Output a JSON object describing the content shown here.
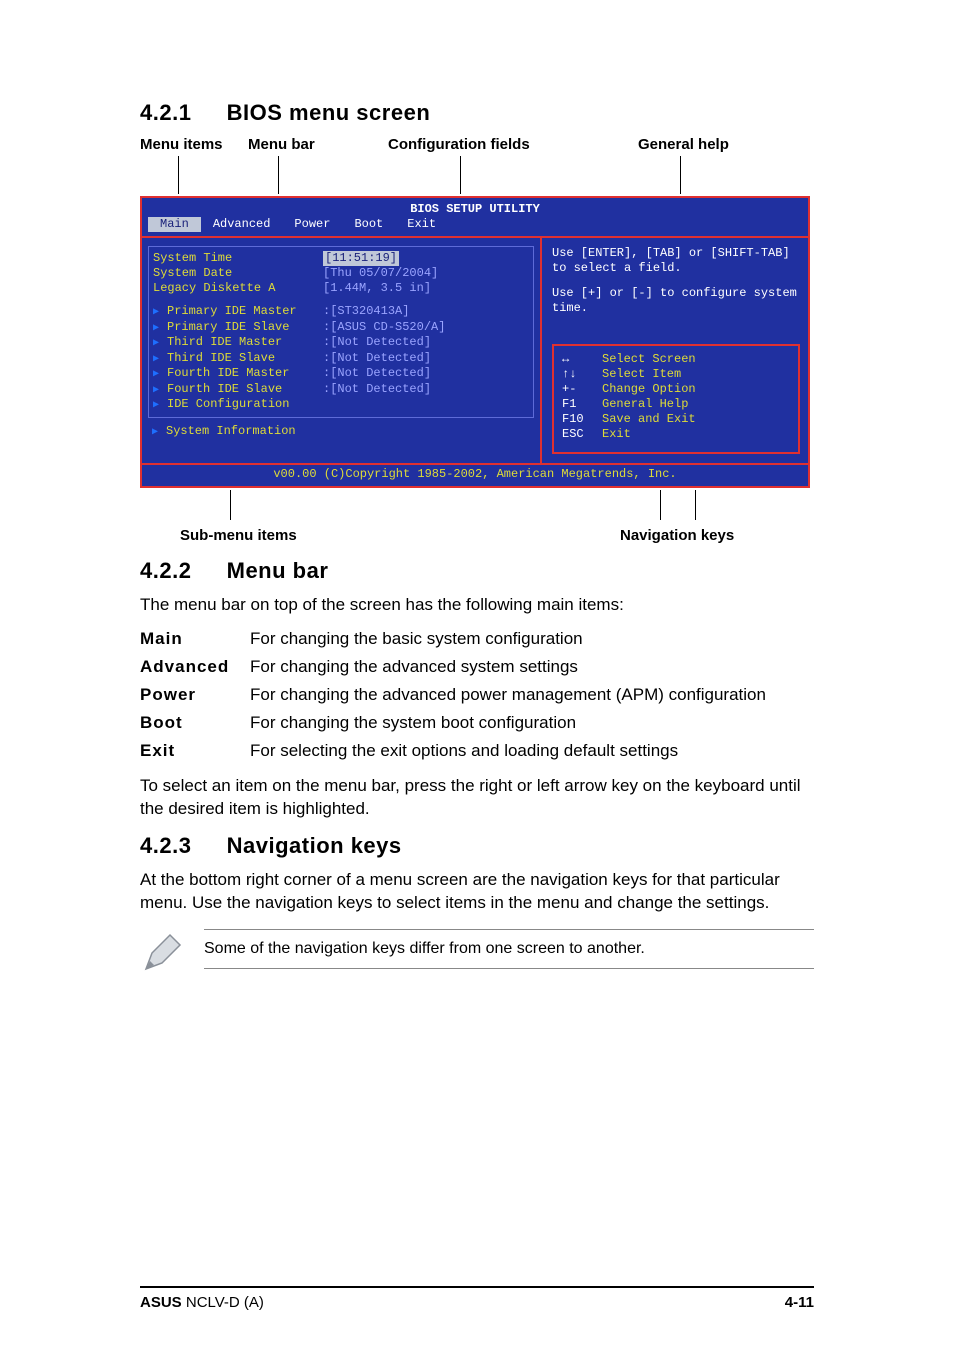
{
  "sections": {
    "s1": {
      "num": "4.2.1",
      "title": "BIOS menu screen"
    },
    "s2": {
      "num": "4.2.2",
      "title": "Menu bar"
    },
    "s3": {
      "num": "4.2.3",
      "title": "Navigation keys"
    }
  },
  "callouts": {
    "menu_items": "Menu items",
    "menu_bar": "Menu bar",
    "config_fields": "Configuration fields",
    "general_help": "General help",
    "submenu_items": "Sub-menu items",
    "nav_keys": "Navigation keys"
  },
  "bios": {
    "title": "BIOS SETUP UTILITY",
    "tabs": [
      "Main",
      "Advanced",
      "Power",
      "Boot",
      "Exit"
    ],
    "selected_tab": "Main",
    "top_rows": [
      {
        "label": "System Time",
        "value": "[11:51:19]",
        "sel": true
      },
      {
        "label": "System Date",
        "value": "[Thu 05/07/2004]"
      },
      {
        "label": "Legacy Diskette A",
        "value": "[1.44M, 3.5 in]"
      }
    ],
    "ide_rows": [
      {
        "label": "Primary IDE Master",
        "value": "[ST320413A]"
      },
      {
        "label": "Primary IDE Slave",
        "value": "[ASUS CD-S520/A]"
      },
      {
        "label": "Third IDE Master",
        "value": "[Not Detected]"
      },
      {
        "label": "Third IDE Slave",
        "value": "[Not Detected]"
      },
      {
        "label": "Fourth IDE Master",
        "value": "[Not Detected]"
      },
      {
        "label": "Fourth IDE Slave",
        "value": "[Not Detected]"
      },
      {
        "label": "IDE Configuration",
        "value": ""
      }
    ],
    "sys_info": "System Information",
    "help1": "Use [ENTER], [TAB] or [SHIFT-TAB] to select a field.",
    "help2": "Use [+] or [-] to configure system time.",
    "nav": [
      {
        "key": "↔",
        "label": "Select Screen"
      },
      {
        "key": "↑↓",
        "label": "Select Item"
      },
      {
        "key": "+-",
        "label": "Change Option"
      },
      {
        "key": "F1",
        "label": "General Help"
      },
      {
        "key": "F10",
        "label": "Save and Exit"
      },
      {
        "key": "ESC",
        "label": "Exit"
      }
    ],
    "copyright": "v00.00 (C)Copyright 1985-2002, American Megatrends, Inc."
  },
  "menubar_intro": "The menu bar on top of the screen has the following main items:",
  "menubar_items": [
    {
      "term": "Main",
      "desc": "For changing the basic system configuration"
    },
    {
      "term": "Advanced",
      "desc": "For changing the advanced system settings"
    },
    {
      "term": "Power",
      "desc": "For changing the advanced power management (APM) configuration"
    },
    {
      "term": "Boot",
      "desc": "For changing the system boot configuration"
    },
    {
      "term": "Exit",
      "desc": "For selecting the exit options and loading default settings"
    }
  ],
  "menubar_outro": "To select an item on the menu bar, press the right or left arrow key on the keyboard until the desired item is highlighted.",
  "navkeys_para": "At the bottom right corner of a menu screen are the navigation keys for that particular menu. Use the navigation keys to select items in the menu and change the settings.",
  "note_text": "Some of the navigation keys differ from one screen to another.",
  "footer": {
    "left_bold": "ASUS",
    "left_rest": " NCLV-D (A)",
    "right": "4-11"
  }
}
